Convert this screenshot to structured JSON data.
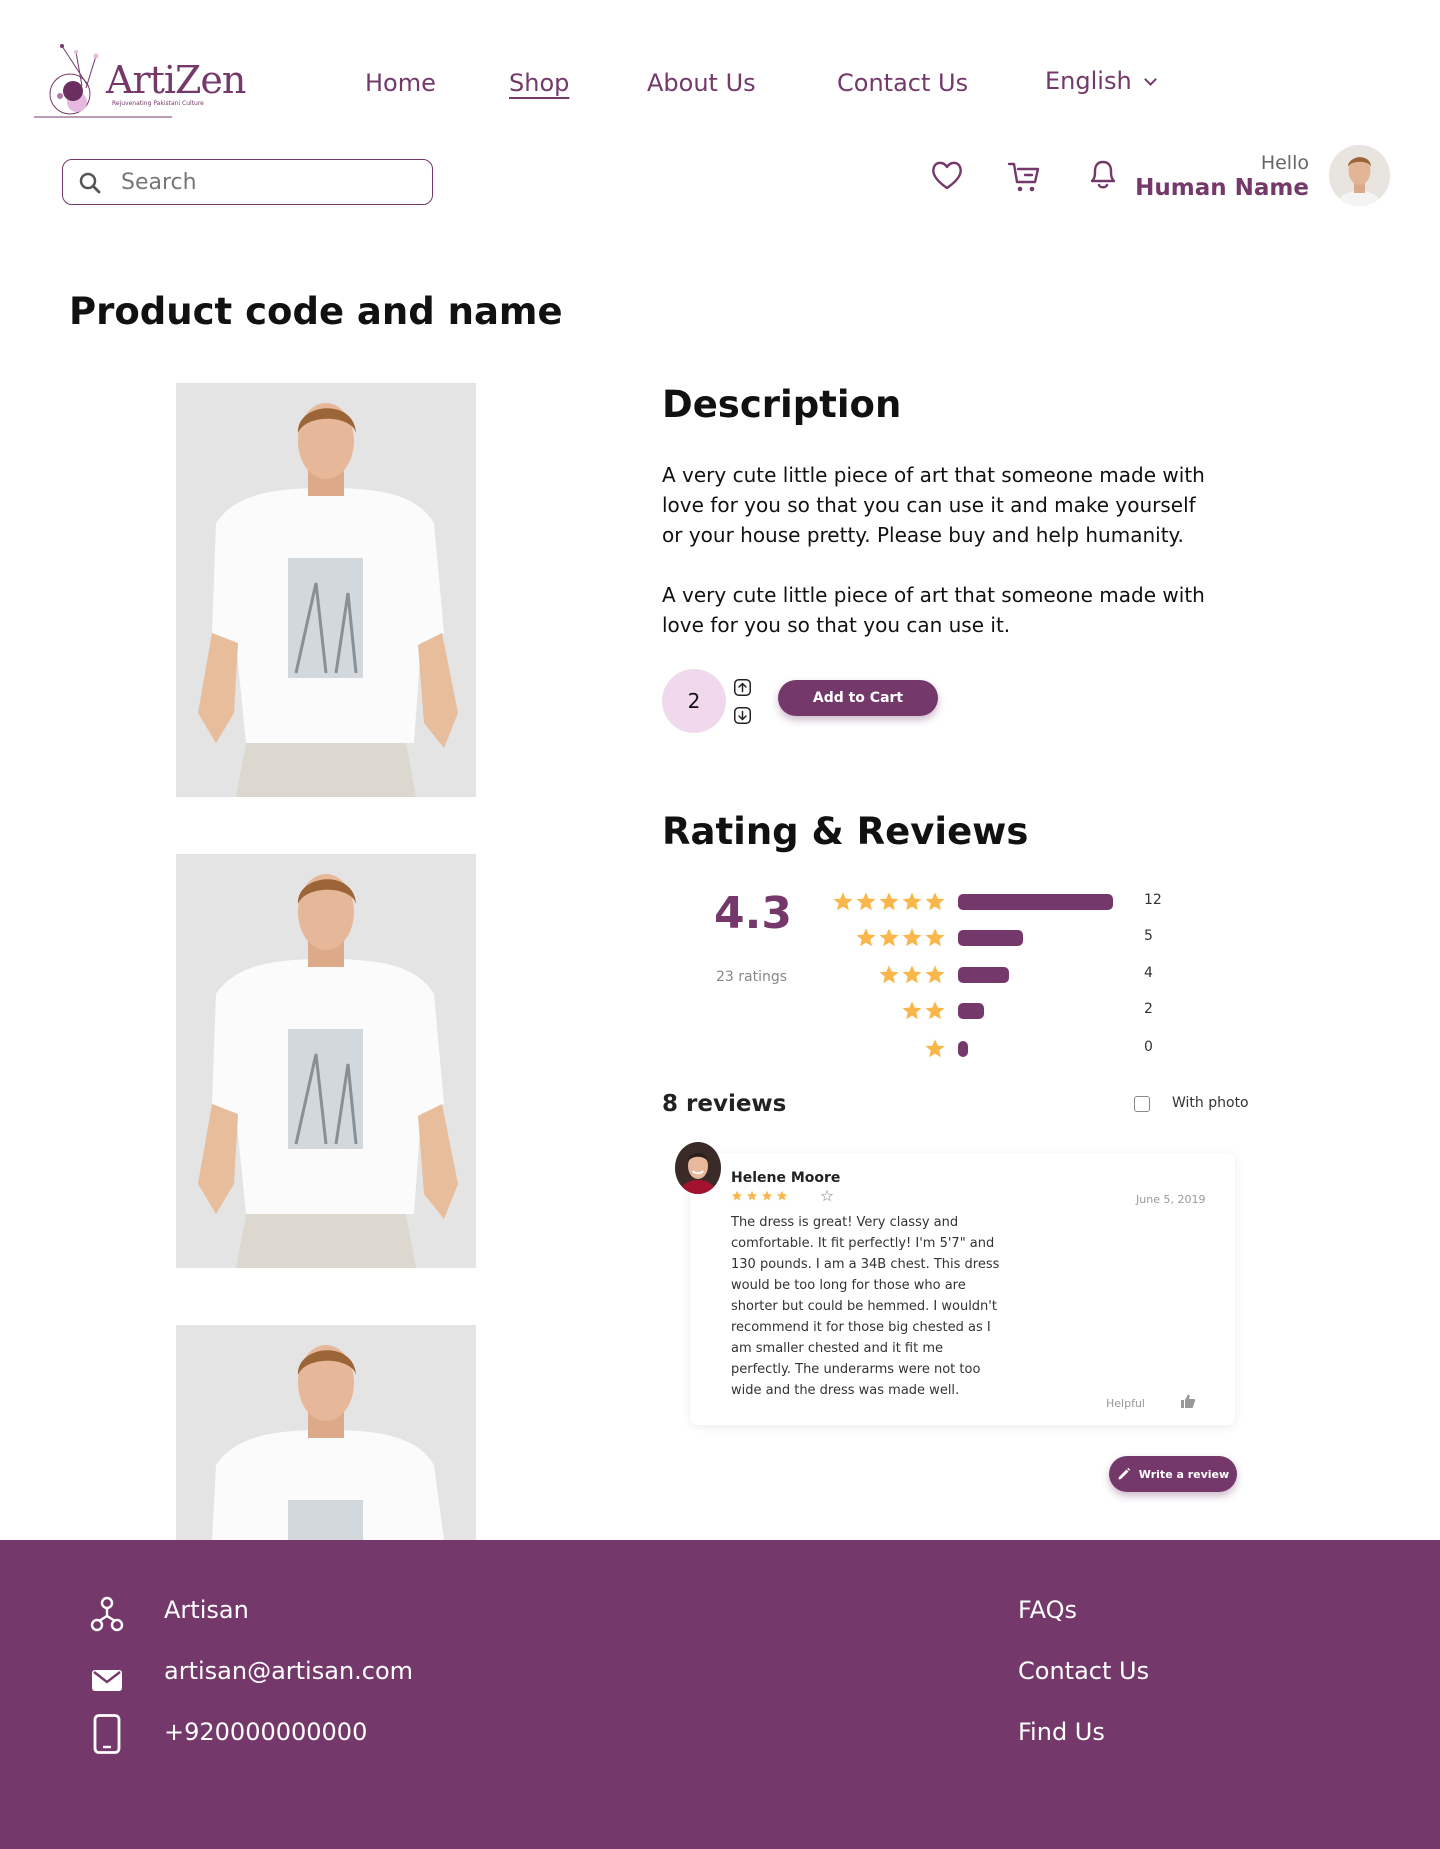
{
  "brand": {
    "name": "ArtiZen",
    "tagline": "Rejuvenating Pakistani Culture",
    "color": "#74396a"
  },
  "nav": {
    "items": [
      "Home",
      "Shop",
      "About Us",
      "Contact Us"
    ],
    "active": "Shop",
    "language": "English"
  },
  "search": {
    "placeholder": "Search",
    "value": ""
  },
  "header_icons": [
    "heart-icon",
    "cart-icon",
    "bell-icon"
  ],
  "user": {
    "greeting": "Hello",
    "name": "Human Name"
  },
  "product": {
    "title": "Product code and name",
    "image_count_visible": 3
  },
  "description": {
    "heading": "Description",
    "paragraphs": [
      "A very cute little piece of art that someone made with love for you so that you can use it and make yourself or your house pretty. Please buy and help humanity.",
      "A very cute little piece of art that someone made with love for you so that you can use it."
    ]
  },
  "cart": {
    "quantity": "2",
    "add_label": "Add to Cart"
  },
  "ratings": {
    "heading": "Rating & Reviews",
    "average": "4.3",
    "count_label": "23 ratings",
    "breakdown": [
      {
        "stars": 5,
        "count": "12",
        "fraction": 1.0
      },
      {
        "stars": 4,
        "count": "5",
        "fraction": 0.42
      },
      {
        "stars": 3,
        "count": "4",
        "fraction": 0.33
      },
      {
        "stars": 2,
        "count": "2",
        "fraction": 0.17
      },
      {
        "stars": 1,
        "count": "0",
        "fraction": 0.0
      }
    ],
    "star_color": "#f9b64a"
  },
  "reviews": {
    "heading": "8 reviews",
    "filter_label": "With photo",
    "items": [
      {
        "name": "Helene Moore",
        "stars": 4,
        "date": "June 5, 2019",
        "text": "The dress is great! Very classy and comfortable. It fit perfectly! I'm 5'7\" and 130 pounds. I am a 34B chest. This dress would be too long for those who are shorter but could be hemmed. I wouldn't recommend it for those big chested as I am smaller chested and it fit me perfectly. The underarms were not too wide and the dress was made well.",
        "helpful_label": "Helpful"
      }
    ],
    "write_label": "Write a review"
  },
  "footer": {
    "contact": {
      "name": "Artisan",
      "email": "artisan@artisan.com",
      "phone": "+920000000000"
    },
    "links": [
      "FAQs",
      "Contact Us",
      "Find Us"
    ]
  }
}
